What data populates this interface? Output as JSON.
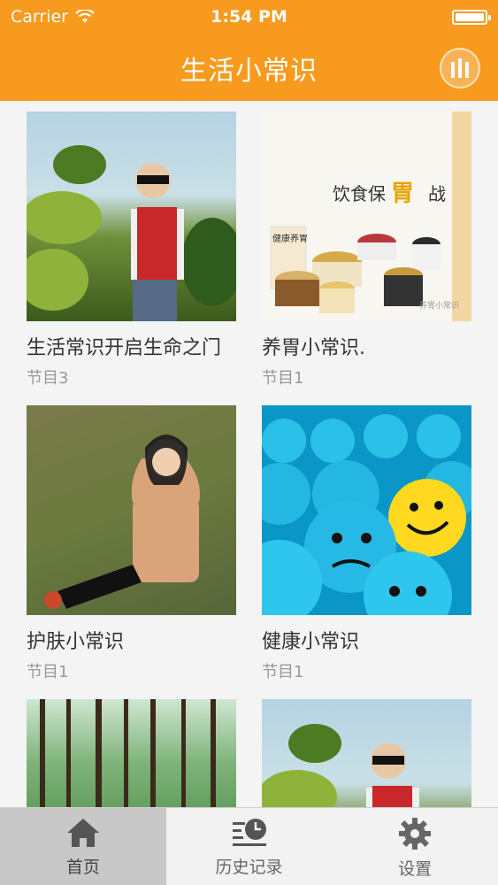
{
  "status_bar": {
    "carrier": "Carrier",
    "time": "1:54 PM"
  },
  "nav": {
    "title": "生活小常识",
    "menu_icon": "equalizer-icon"
  },
  "cards": [
    {
      "title": "生活常识开启生命之门",
      "subtitle": "节目3"
    },
    {
      "title": "养胃小常识.",
      "subtitle": "节目1",
      "image_text": {
        "a": "饮食保",
        "b": "胃",
        "c": "战",
        "small_label": "健康养胃",
        "watermark": "养胃小常识"
      }
    },
    {
      "title": "护肤小常识",
      "subtitle": "节目1"
    },
    {
      "title": "健康小常识",
      "subtitle": "节目1"
    },
    {
      "title": "",
      "subtitle": ""
    },
    {
      "title": "",
      "subtitle": ""
    }
  ],
  "tabs": [
    {
      "label": "首页",
      "icon": "home-icon",
      "active": true
    },
    {
      "label": "历史记录",
      "icon": "history-icon",
      "active": false
    },
    {
      "label": "设置",
      "icon": "gear-icon",
      "active": false
    }
  ],
  "colors": {
    "brand_orange": "#f79a1e",
    "tab_active": "#c8c8c8"
  }
}
